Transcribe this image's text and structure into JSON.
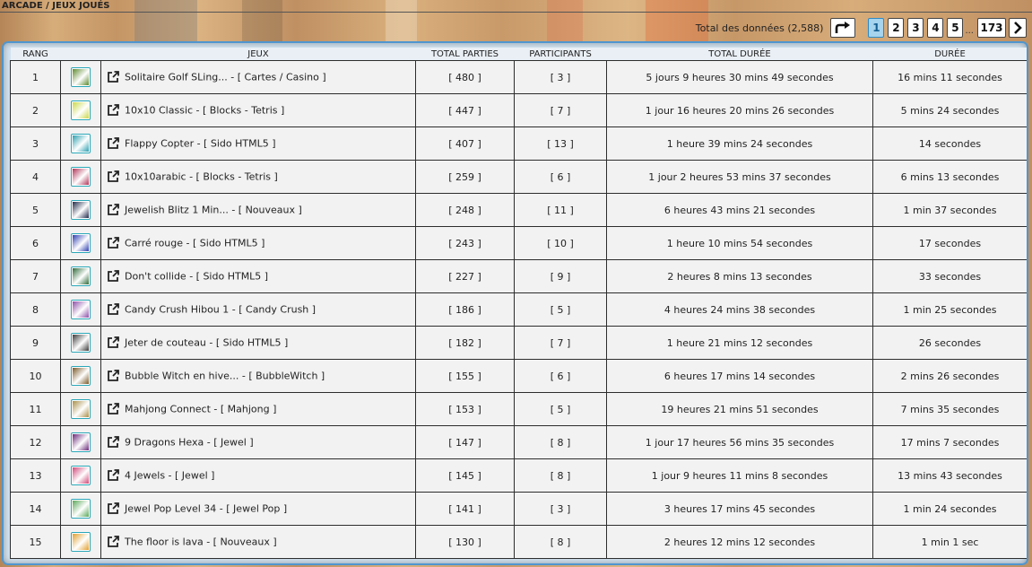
{
  "breadcrumb": "ARCADE / JEUX JOUÉS",
  "pagination": {
    "total_label": "Total des données (2,588)",
    "pages": [
      "1",
      "2",
      "3",
      "4",
      "5"
    ],
    "current": "1",
    "ellipsis": "...",
    "last_page": "173"
  },
  "table": {
    "headers": {
      "rank": "RANG",
      "games": "JEUX",
      "total_plays": "TOTAL PARTIES",
      "participants": "PARTICIPANTS",
      "total_duration": "TOTAL DURÉE",
      "duration": "DURÉE"
    },
    "rows": [
      {
        "rank": "1",
        "game": "Solitaire Golf SLing... - [ Cartes / Casino ]",
        "plays": "[ 480 ]",
        "participants": "[ 3 ]",
        "total_duration": "5 jours 9 heures 30 mins 49 secondes",
        "duration": "16 mins 11 secondes",
        "thumb_color": "#5d8a2f"
      },
      {
        "rank": "2",
        "game": "10x10 Classic - [ Blocks - Tetris ]",
        "plays": "[ 447 ]",
        "participants": "[ 7 ]",
        "total_duration": "1 jour 16 heures 20 mins 26 secondes",
        "duration": "5 mins 24 secondes",
        "thumb_color": "#c9d84a"
      },
      {
        "rank": "3",
        "game": "Flappy Copter - [ Sido HTML5 ]",
        "plays": "[ 407 ]",
        "participants": "[ 13 ]",
        "total_duration": "1 heure 39 mins 24 secondes",
        "duration": "14 secondes",
        "thumb_color": "#2a9fb0"
      },
      {
        "rank": "4",
        "game": "10x10arabic - [ Blocks - Tetris ]",
        "plays": "[ 259 ]",
        "participants": "[ 6 ]",
        "total_duration": "1 jour 2 heures 53 mins 37 secondes",
        "duration": "6 mins 13 secondes",
        "thumb_color": "#b0365a"
      },
      {
        "rank": "5",
        "game": "Jewelish Blitz 1 Min... - [ Nouveaux ]",
        "plays": "[ 248 ]",
        "participants": "[ 11 ]",
        "total_duration": "6 heures 43 mins 21 secondes",
        "duration": "1 min 37 secondes",
        "thumb_color": "#1f2a4a"
      },
      {
        "rank": "6",
        "game": "Carré rouge - [ Sido HTML5 ]",
        "plays": "[ 243 ]",
        "participants": "[ 10 ]",
        "total_duration": "1 heure 10 mins 54 secondes",
        "duration": "17 secondes",
        "thumb_color": "#2d3fb0"
      },
      {
        "rank": "7",
        "game": "Don't collide - [ Sido HTML5 ]",
        "plays": "[ 227 ]",
        "participants": "[ 9 ]",
        "total_duration": "2 heures 8 mins 13 secondes",
        "duration": "33 secondes",
        "thumb_color": "#2f6b3a"
      },
      {
        "rank": "8",
        "game": "Candy Crush Hibou 1 - [ Candy Crush ]",
        "plays": "[ 186 ]",
        "participants": "[ 5 ]",
        "total_duration": "4 heures 24 mins 38 secondes",
        "duration": "1 min 25 secondes",
        "thumb_color": "#8a4fa8"
      },
      {
        "rank": "9",
        "game": "Jeter de couteau - [ Sido HTML5 ]",
        "plays": "[ 182 ]",
        "participants": "[ 7 ]",
        "total_duration": "1 heure 21 mins 12 secondes",
        "duration": "26 secondes",
        "thumb_color": "#3a3a3a"
      },
      {
        "rank": "10",
        "game": "Bubble Witch en hive... - [ BubbleWitch ]",
        "plays": "[ 155 ]",
        "participants": "[ 6 ]",
        "total_duration": "6 heures 17 mins 14 secondes",
        "duration": "2 mins 26 secondes",
        "thumb_color": "#7a5a2a"
      },
      {
        "rank": "11",
        "game": "Mahjong Connect - [ Mahjong ]",
        "plays": "[ 153 ]",
        "participants": "[ 5 ]",
        "total_duration": "19 heures 21 mins 51 secondes",
        "duration": "7 mins 35 secondes",
        "thumb_color": "#a8904a"
      },
      {
        "rank": "12",
        "game": "9 Dragons Hexa - [ Jewel ]",
        "plays": "[ 147 ]",
        "participants": "[ 8 ]",
        "total_duration": "1 jour 17 heures 56 mins 35 secondes",
        "duration": "17 mins 7 secondes",
        "thumb_color": "#6a2a7a"
      },
      {
        "rank": "13",
        "game": "4 Jewels - [ Jewel ]",
        "plays": "[ 145 ]",
        "participants": "[ 8 ]",
        "total_duration": "1 jour 9 heures 11 mins 8 secondes",
        "duration": "13 mins 43 secondes",
        "thumb_color": "#d04a7a"
      },
      {
        "rank": "14",
        "game": "Jewel Pop Level 34 - [ Jewel Pop ]",
        "plays": "[ 141 ]",
        "participants": "[ 3 ]",
        "total_duration": "3 heures 17 mins 45 secondes",
        "duration": "1 min 24 secondes",
        "thumb_color": "#5aa85a"
      },
      {
        "rank": "15",
        "game": "The floor is lava - [ Nouveaux ]",
        "plays": "[ 130 ]",
        "participants": "[ 8 ]",
        "total_duration": "2 heures 12 mins 12 secondes",
        "duration": "1 min 1 sec",
        "thumb_color": "#e0a030"
      }
    ]
  },
  "colors": {
    "panel_border": "#4f96cf",
    "active_page": "#a6d3ee",
    "thumb_border": "#2aa7b8"
  },
  "icons": {
    "go": "go-to-page-arrow-icon",
    "next": "next-page-chevron-icon",
    "external": "external-link-icon"
  }
}
